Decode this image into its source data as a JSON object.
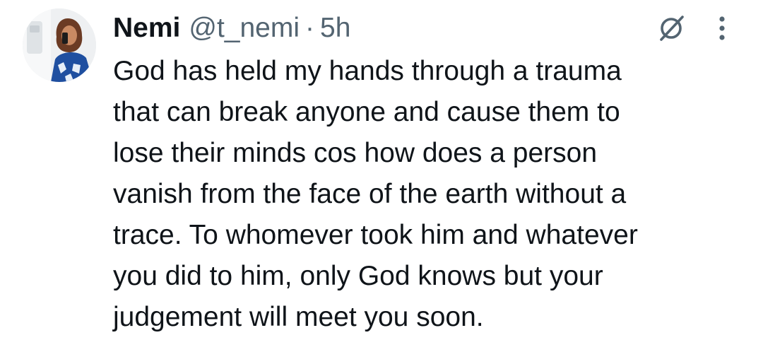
{
  "tweet": {
    "author": {
      "name": "Nemi",
      "handle": "@t_nemi",
      "separator": "·",
      "time": "5h",
      "avatar_icon": "profile-photo"
    },
    "text": "God has held my hands through a trauma\nthat can break anyone and cause them to\nlose their minds cos how does a person\nvanish from the face of the earth without a\ntrace. To whomever took him and whatever\nyou did to him, only God knows but your\njudgement will meet you soon.",
    "actions": {
      "grok_icon": "grok-icon",
      "more_icon": "more-vertical-icon"
    }
  },
  "colors": {
    "text_primary": "#0f1419",
    "text_secondary": "#536471",
    "background": "#ffffff"
  }
}
